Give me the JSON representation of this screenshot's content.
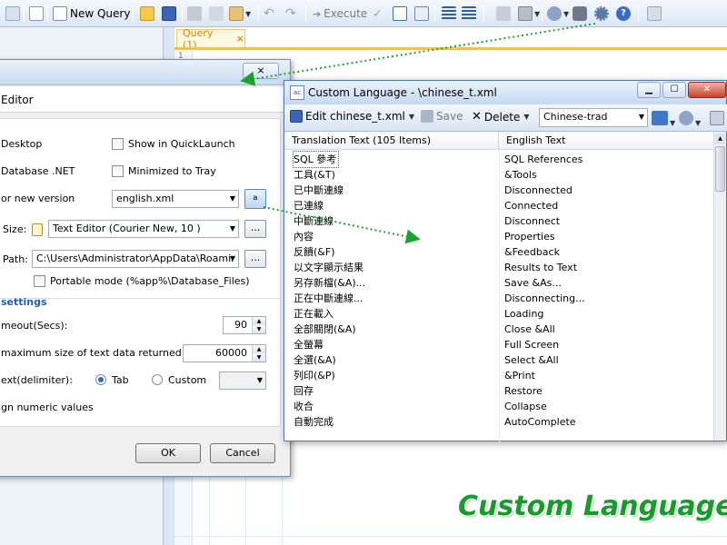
{
  "toolbar": {
    "new_query_label": "New Query",
    "execute_label": "Execute"
  },
  "query_tab": {
    "label": "Query (1)",
    "close": "×"
  },
  "gutter_line": "1",
  "options_dialog": {
    "close": "⨯",
    "subheader": "Editor",
    "items": {
      "desktop": "Desktop",
      "show_quicklaunch": "Show in QuickLaunch",
      "database_net": "Database .NET",
      "minimized_tray": "Minimized to Tray",
      "new_version": "or new version",
      "language_value": "english.xml",
      "size_label": "Size:",
      "size_value": "Text Editor (Courier New, 10 )",
      "path_label": "Path:",
      "path_value": "C:\\Users\\Administrator\\AppData\\Roamir",
      "portable_mode": "Portable mode (%app%\\Database_Files)",
      "settings_title": "settings",
      "timeout_label": "meout(Secs):",
      "timeout_value": "90",
      "maxsize_label": "maximum size of text data returned:",
      "maxsize_value": "60000",
      "delimiter_label": "ext(delimiter):",
      "tab_label": "Tab",
      "custom_label": "Custom",
      "align_label": "gn numeric values"
    },
    "browse_label": "...",
    "ok_label": "OK",
    "cancel_label": "Cancel"
  },
  "custom_language": {
    "title": "Custom Language - \\chinese_t.xml",
    "edit_label": "Edit chinese_t.xml",
    "save_label": "Save",
    "delete_label": "Delete",
    "language_select": "Chinese-trad",
    "col_translation": "Translation Text (105 Items)",
    "col_english": "English Text",
    "rows": [
      {
        "t": "SQL 參考",
        "e": "SQL References"
      },
      {
        "t": "工具(&T)",
        "e": "&Tools"
      },
      {
        "t": "已中斷連線",
        "e": "Disconnected"
      },
      {
        "t": "已連線",
        "e": "Connected"
      },
      {
        "t": "中斷連線",
        "e": "Disconnect"
      },
      {
        "t": "內容",
        "e": "Properties"
      },
      {
        "t": "反饋(&F)",
        "e": "&Feedback"
      },
      {
        "t": "以文字顯示結果",
        "e": "Results to Text"
      },
      {
        "t": "另存新檔(&A)...",
        "e": "Save &As..."
      },
      {
        "t": "正在中斷連線...",
        "e": "Disconnecting..."
      },
      {
        "t": "正在載入",
        "e": "Loading"
      },
      {
        "t": "全部關閉(&A)",
        "e": "Close &All"
      },
      {
        "t": "全螢幕",
        "e": "Full Screen"
      },
      {
        "t": "全選(&A)",
        "e": "Select &All"
      },
      {
        "t": "列印(&P)",
        "e": "&Print"
      },
      {
        "t": "回存",
        "e": "Restore"
      },
      {
        "t": "收合",
        "e": "Collapse"
      },
      {
        "t": "自動完成",
        "e": "AutoComplete"
      }
    ]
  },
  "watermark": "Custom Language",
  "colors": {
    "accent": "#1d5fb4",
    "watermark": "#1a9a2e",
    "tab": "#d08a00"
  }
}
